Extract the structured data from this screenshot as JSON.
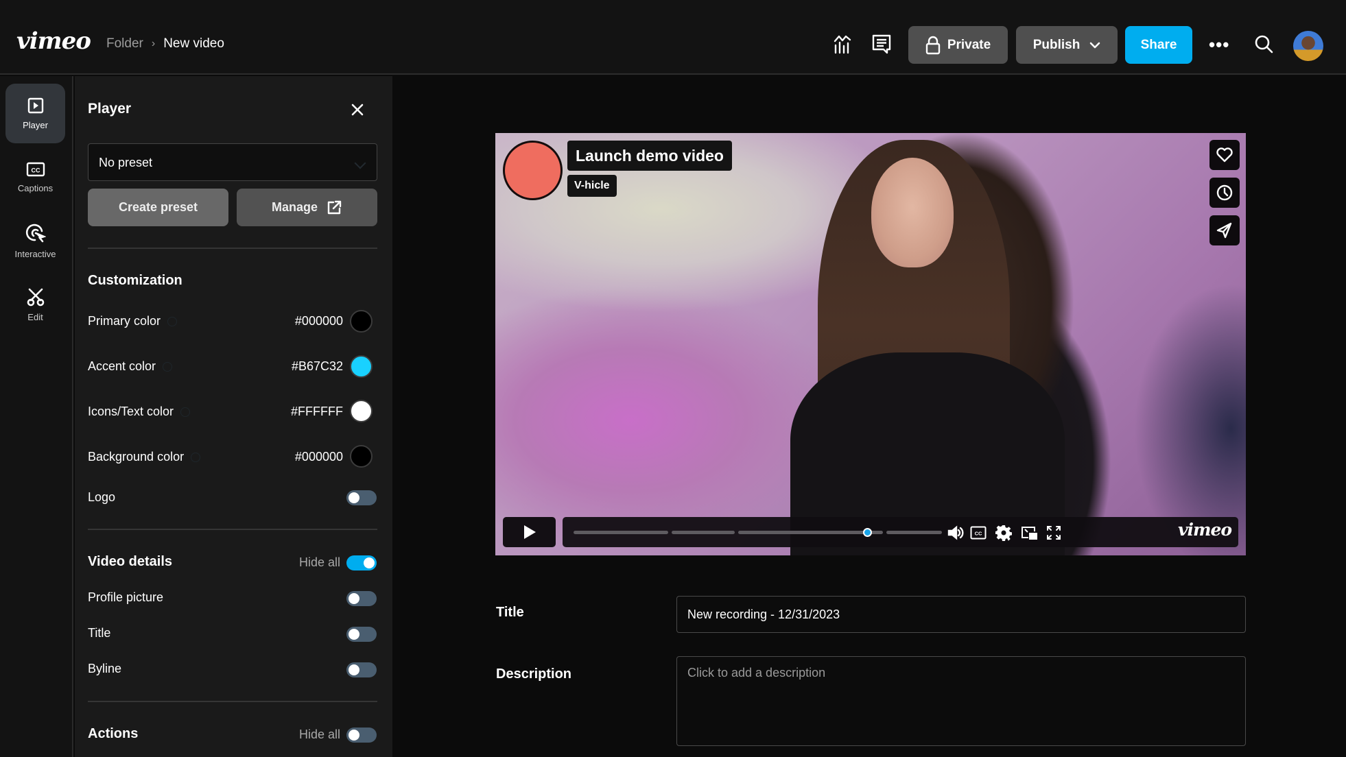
{
  "header": {
    "logo": "vimeo",
    "breadcrumb": {
      "folder": "Folder",
      "separator": "›",
      "current": "New video"
    },
    "icons": {
      "analytics": "analytics-icon",
      "comments": "comments-icon",
      "more": "•••",
      "search": "search-icon",
      "avatar": "user-avatar"
    },
    "buttons": {
      "private": "Private",
      "publish": "Publish",
      "share": "Share"
    }
  },
  "rail": {
    "items": [
      {
        "label": "Player",
        "icon": "player-icon",
        "active": true
      },
      {
        "label": "Captions",
        "icon": "captions-icon",
        "active": false
      },
      {
        "label": "Interactive",
        "icon": "interactive-icon",
        "active": false
      },
      {
        "label": "Edit",
        "icon": "scissors-icon",
        "active": false
      }
    ]
  },
  "panel": {
    "title": "Player",
    "preset": {
      "selected": "No preset"
    },
    "buttons": {
      "create_preset": "Create preset",
      "manage": "Manage"
    },
    "customization": {
      "title": "Customization",
      "rows": [
        {
          "label": "Primary color",
          "hex": "#000000",
          "swatch": "#000000"
        },
        {
          "label": "Accent color",
          "hex": "#B67C32",
          "swatch": "#19d1ff"
        },
        {
          "label": "Icons/Text color",
          "hex": "#FFFFFF",
          "swatch": "#ffffff"
        },
        {
          "label": "Background color",
          "hex": "#000000",
          "swatch": "#000000"
        }
      ],
      "logo": {
        "label": "Logo",
        "on": false
      }
    },
    "video_details": {
      "title": "Video details",
      "hide_all_label": "Hide all",
      "hide_all_on": true,
      "rows": [
        {
          "label": "Profile picture",
          "on": false
        },
        {
          "label": "Title",
          "on": false
        },
        {
          "label": "Byline",
          "on": false
        }
      ]
    },
    "actions": {
      "title": "Actions",
      "hide_all_label": "Hide all",
      "hide_all_on": false
    }
  },
  "player": {
    "title": "Launch demo video",
    "byline": "V-hicle",
    "avatar_color": "#ef6d5f",
    "side_actions": [
      "like-icon",
      "watch-later-icon",
      "share-icon"
    ],
    "progress_fraction": 0.8,
    "chapter_segments": 4,
    "controls": [
      "volume-icon",
      "captions-icon",
      "settings-icon",
      "picture-in-picture-icon",
      "fullscreen-icon"
    ],
    "logo": "vimeo",
    "accent_color": "#19a5ea"
  },
  "details": {
    "title_label": "Title",
    "title_value": "New recording - 12/31/2023",
    "description_label": "Description",
    "description_placeholder": "Click to add a description"
  }
}
